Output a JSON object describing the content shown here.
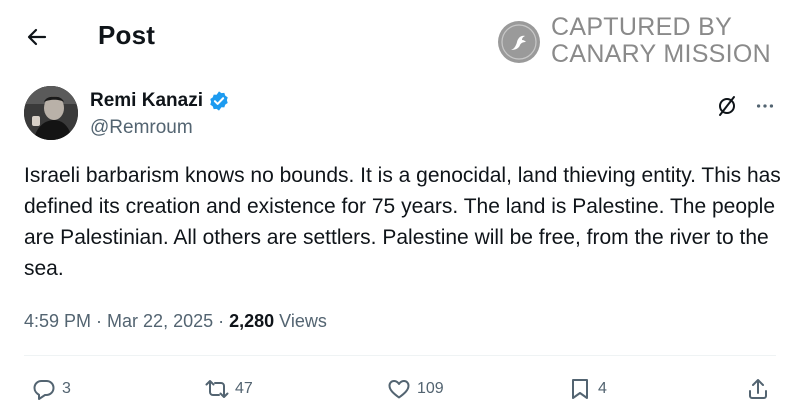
{
  "header": {
    "title": "Post",
    "back_icon": "back-arrow-icon"
  },
  "watermark": {
    "line1": "CAPTURED BY",
    "line2": "CANARY MISSION"
  },
  "author": {
    "name": "Remi Kanazi",
    "handle": "@Remroum",
    "verified_icon": "verified-badge-icon",
    "verified_color": "#1d9bf0"
  },
  "post": {
    "text": "Israeli barbarism knows no bounds. It is a genocidal, land thieving entity. This has defined its creation and existence for 75 years. The land is Palestine. The people are Palestinian. All others are settlers. Palestine will be free, from the river to the sea."
  },
  "meta": {
    "time": "4:59 PM",
    "sep1": " · ",
    "date": "Mar 22, 2025",
    "sep2": " · ",
    "views": "2,280",
    "views_label": " Views"
  },
  "actions": {
    "replies": "3",
    "reposts": "47",
    "likes": "109",
    "bookmarks": "4"
  },
  "colors": {
    "text": "#0f1419",
    "muted": "#536471",
    "accent": "#1d9bf0",
    "watermark": "#8a8a8a"
  }
}
